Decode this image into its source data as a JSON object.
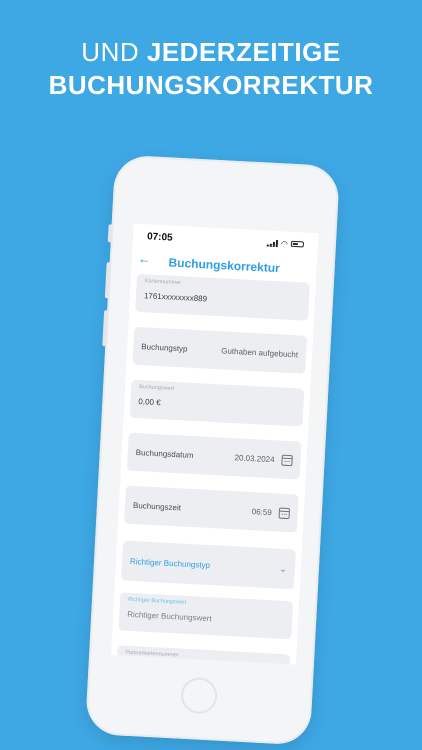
{
  "headline": {
    "line1_light": "UND ",
    "line1_bold": "JEDERZEITIGE",
    "line2_bold": "BUCHUNGSKORREKTUR"
  },
  "status": {
    "time": "07:05"
  },
  "appbar": {
    "back_icon": "arrow-left-icon",
    "title": "Buchungskorrektur"
  },
  "form": {
    "card_number": {
      "label": "Kartennummer",
      "value": "1761xxxxxxxx889"
    },
    "booking_type": {
      "label": "Buchungstyp",
      "value": "Guthaben aufgebucht"
    },
    "booking_value": {
      "label": "Buchungswert",
      "value": "0,00 €"
    },
    "booking_date": {
      "label": "Buchungsdatum",
      "value": "20.03.2024",
      "icon": "calendar-icon"
    },
    "booking_time": {
      "label": "Buchungszeit",
      "value": "06:59",
      "icon": "calendar-icon"
    },
    "correct_type": {
      "label": "Richtiger Buchungstyp",
      "icon": "chevron-down-icon"
    },
    "correct_value": {
      "label": "Richtiger Buchungswert",
      "placeholder": "Richtiger Buchungswert"
    },
    "partner_number": {
      "label": "Partnerkartennummer"
    }
  },
  "colors": {
    "background": "#3ea8e5",
    "accent": "#2d9fe2",
    "field": "#eceef1"
  }
}
